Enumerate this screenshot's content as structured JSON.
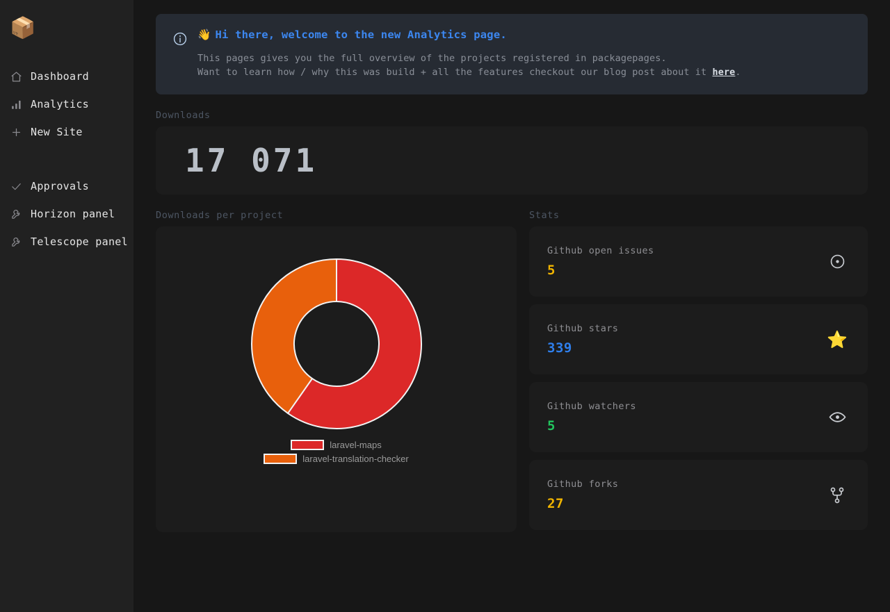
{
  "app": {
    "logo_icon": "package-box-icon",
    "logo_glyph": "📦"
  },
  "sidebar": {
    "primary_items": [
      {
        "label": "Dashboard",
        "icon": "home-icon"
      },
      {
        "label": "Analytics",
        "icon": "bar-chart-icon"
      },
      {
        "label": "New Site",
        "icon": "plus-icon"
      }
    ],
    "secondary_items": [
      {
        "label": "Approvals",
        "icon": "check-icon"
      },
      {
        "label": "Horizon panel",
        "icon": "wrench-icon"
      },
      {
        "label": "Telescope panel",
        "icon": "wrench-icon"
      }
    ]
  },
  "banner": {
    "icon": "info-circle-icon",
    "wave_glyph": "👋",
    "title": "Hi there, welcome to the new Analytics page.",
    "line1": "This pages gives you the full overview of the projects registered in packagepages.",
    "line2_before": "Want to learn how / why this was build + all the features checkout our blog post about it ",
    "line2_link": "here",
    "line2_after": ".",
    "title_color": "#3c87f0",
    "background": "#262b33"
  },
  "downloads": {
    "section_label": "Downloads",
    "value": "17 071"
  },
  "chart_section": {
    "section_label": "Downloads per project"
  },
  "chart_data": {
    "type": "pie",
    "title": "Downloads per project",
    "variant": "donut",
    "hole_ratio": 0.5,
    "start_angle_deg": 0,
    "direction": "clockwise",
    "labels": [
      "laravel-maps",
      "laravel-translation-checker"
    ],
    "values": [
      59.7,
      40.3
    ],
    "units": "percent of downloads",
    "colors": [
      "#dc2828",
      "#e8600c"
    ],
    "legend_position": "bottom",
    "grid": false,
    "slice_border_color": "#f2f2f2",
    "segments": [
      {
        "label": "laravel-maps",
        "value": 59.7,
        "color": "#dc2828",
        "start_deg": 0,
        "end_deg": 215
      },
      {
        "label": "laravel-translation-checker",
        "value": 40.3,
        "color": "#e8600c",
        "start_deg": 215,
        "end_deg": 360
      }
    ]
  },
  "stats": {
    "section_label": "Stats",
    "cards": [
      {
        "label": "Github open issues",
        "value": "5",
        "value_color": "#f0b400",
        "icon": "issue-opened-icon"
      },
      {
        "label": "Github stars",
        "value": "339",
        "value_color": "#2f7fec",
        "icon": "star-icon",
        "icon_glyph": "⭐"
      },
      {
        "label": "Github watchers",
        "value": "5",
        "value_color": "#22c55e",
        "icon": "eye-icon"
      },
      {
        "label": "Github forks",
        "value": "27",
        "value_color": "#f0b400",
        "icon": "git-fork-icon"
      }
    ]
  }
}
